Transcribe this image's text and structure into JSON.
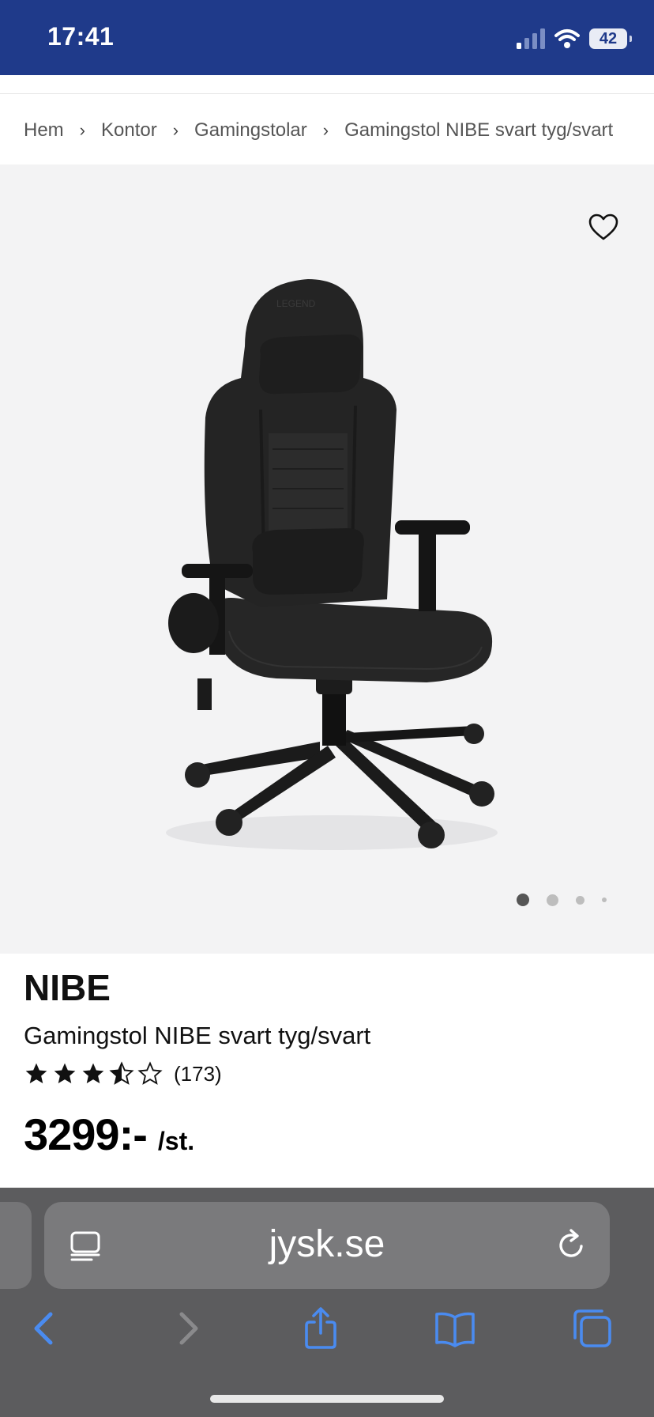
{
  "status_bar": {
    "time": "17:41",
    "battery": "42"
  },
  "breadcrumb": {
    "items": [
      "Hem",
      "Kontor",
      "Gamingstolar",
      "Gamingstol NIBE svart tyg/svart"
    ],
    "separator": "›"
  },
  "gallery": {
    "image_subject": "black fabric gaming chair",
    "chair_logo_text": "LEGEND",
    "dots_count": 4,
    "active_dot": 0
  },
  "product": {
    "brand": "NIBE",
    "name": "Gamingstol NIBE svart tyg/svart",
    "rating": {
      "stars": 3.5,
      "max": 5,
      "count_text": "(173)"
    },
    "price": "3299:-",
    "unit": "/st."
  },
  "browser": {
    "url": "jysk.se"
  },
  "icons": {
    "favorite": "heart-icon",
    "reader": "reader-icon",
    "reload": "reload-icon",
    "back": "chevron-left-icon",
    "forward": "chevron-right-icon",
    "share": "share-icon",
    "bookmarks": "book-icon",
    "tabs": "tabs-icon"
  },
  "colors": {
    "header": "#1f3a8a",
    "browser_bar": "#5c5c5e",
    "toolbar_icons": "#4a8bf0"
  }
}
